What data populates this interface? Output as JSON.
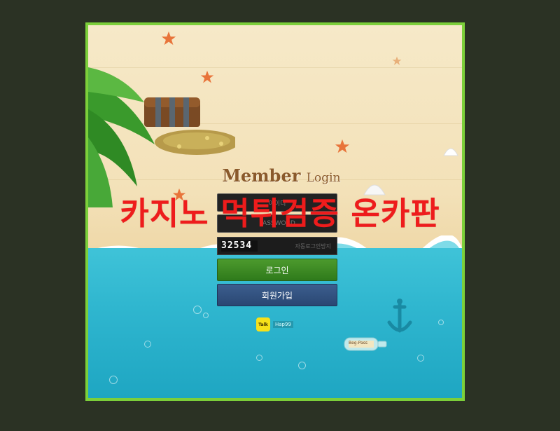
{
  "header": {
    "title_main": "Member",
    "title_sub": "Login"
  },
  "form": {
    "id_placeholder": "아이디",
    "password_placeholder": "PASSWORD",
    "captcha_code": "32534",
    "captcha_hint": "자동로그인방지"
  },
  "buttons": {
    "login_label": "로그인",
    "signup_label": "회원가입"
  },
  "contact": {
    "kakao_badge": "Talk",
    "kakao_id": "Hap99"
  },
  "decor": {
    "bottle_label": "Beg-Pass"
  },
  "overlay": {
    "watermark_text": "카지노 먹튀검증 온카판"
  },
  "colors": {
    "background": "#2b3224",
    "frame_border": "#7ccf3a",
    "login_button": "#3f8a25",
    "signup_button": "#33527f",
    "watermark": "#ee1c1c",
    "sea": "#2fb6cf"
  }
}
